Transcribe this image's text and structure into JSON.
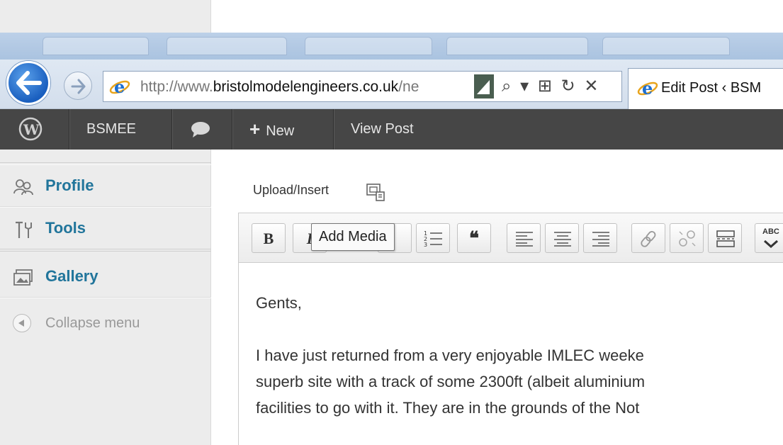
{
  "browser": {
    "url_prefix": "http://www.",
    "url_domain": "bristolmodelengineers.co.uk",
    "url_suffix": "/ne",
    "address_tools": "⌕ ▾ ⊞ ↻ ✕",
    "tab_title": "Edit Post ‹ BSM"
  },
  "adminbar": {
    "site_name": "BSMEE",
    "new_label": "New",
    "view_post_label": "View Post"
  },
  "sidebar": {
    "items": [
      {
        "label": "Profile",
        "icon": "profile-icon"
      },
      {
        "label": "Tools",
        "icon": "tools-icon"
      },
      {
        "label": "Gallery",
        "icon": "gallery-icon"
      }
    ],
    "collapse_label": "Collapse menu"
  },
  "editor": {
    "upload_label": "Upload/Insert",
    "tooltip": "Add Media",
    "toolbar": {
      "bold": "B",
      "italic": "I",
      "blockquote": "❝",
      "more": "ABC"
    },
    "content": {
      "greeting": "Gents,",
      "line1": "I have just returned from a very enjoyable IMLEC weeke",
      "line2": "superb site with a track of some 2300ft (albeit aluminium",
      "line3": "facilities to go with it. They are in the grounds of the Not"
    }
  },
  "colors": {
    "admin_bar": "#464646",
    "link_blue": "#21759b",
    "sidebar_bg": "#ececec"
  }
}
